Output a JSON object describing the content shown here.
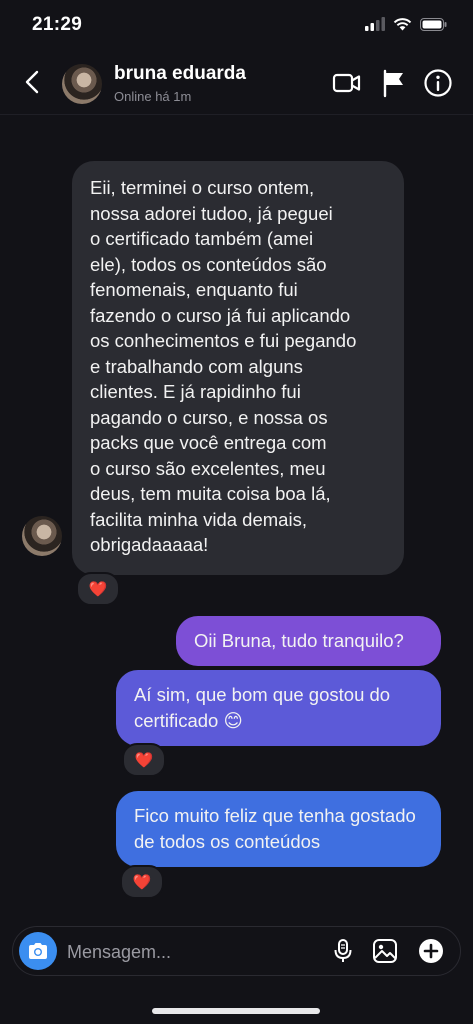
{
  "status_bar": {
    "time": "21:29"
  },
  "header": {
    "contact_name": "bruna eduarda",
    "contact_status": "Online há 1m"
  },
  "messages": {
    "incoming_text": "Eii, terminei o curso ontem,\nnossa adorei tudoo, já peguei\no certificado também (amei\nele), todos os conteúdos são\nfenomenais, enquanto fui\nfazendo o curso já fui aplicando\nos conhecimentos e fui pegando\ne trabalhando com alguns\nclientes. E já rapidinho fui\npagando o curso, e nossa os\npacks que você entrega com\no curso são excelentes, meu\ndeus, tem muita coisa boa lá,\nfacilita minha vida demais,\nobrigadaaaaa!",
    "outgoing_1": "Oii Bruna, tudo tranquilo?",
    "outgoing_2": "Aí sim, que bom que gostou do certificado 😊",
    "outgoing_3": "Fico muito feliz que tenha gostado de todos os conteúdos",
    "reaction": "❤️"
  },
  "composer": {
    "placeholder": "Mensagem..."
  },
  "colors": {
    "background": "#121217",
    "incoming_bubble": "#2b2c32",
    "outgoing_1": "#7d4fd6",
    "outgoing_2": "#5c5ad8",
    "outgoing_3": "#3f6fe0",
    "camera_button": "#3b8ef0",
    "heart": "#e8334a"
  },
  "icons": {
    "status": [
      "signal-icon",
      "wifi-icon",
      "battery-icon"
    ],
    "header": [
      "back-icon",
      "video-call-icon",
      "flag-icon",
      "info-icon"
    ],
    "composer": [
      "camera-icon",
      "microphone-icon",
      "gallery-icon",
      "plus-icon"
    ]
  }
}
